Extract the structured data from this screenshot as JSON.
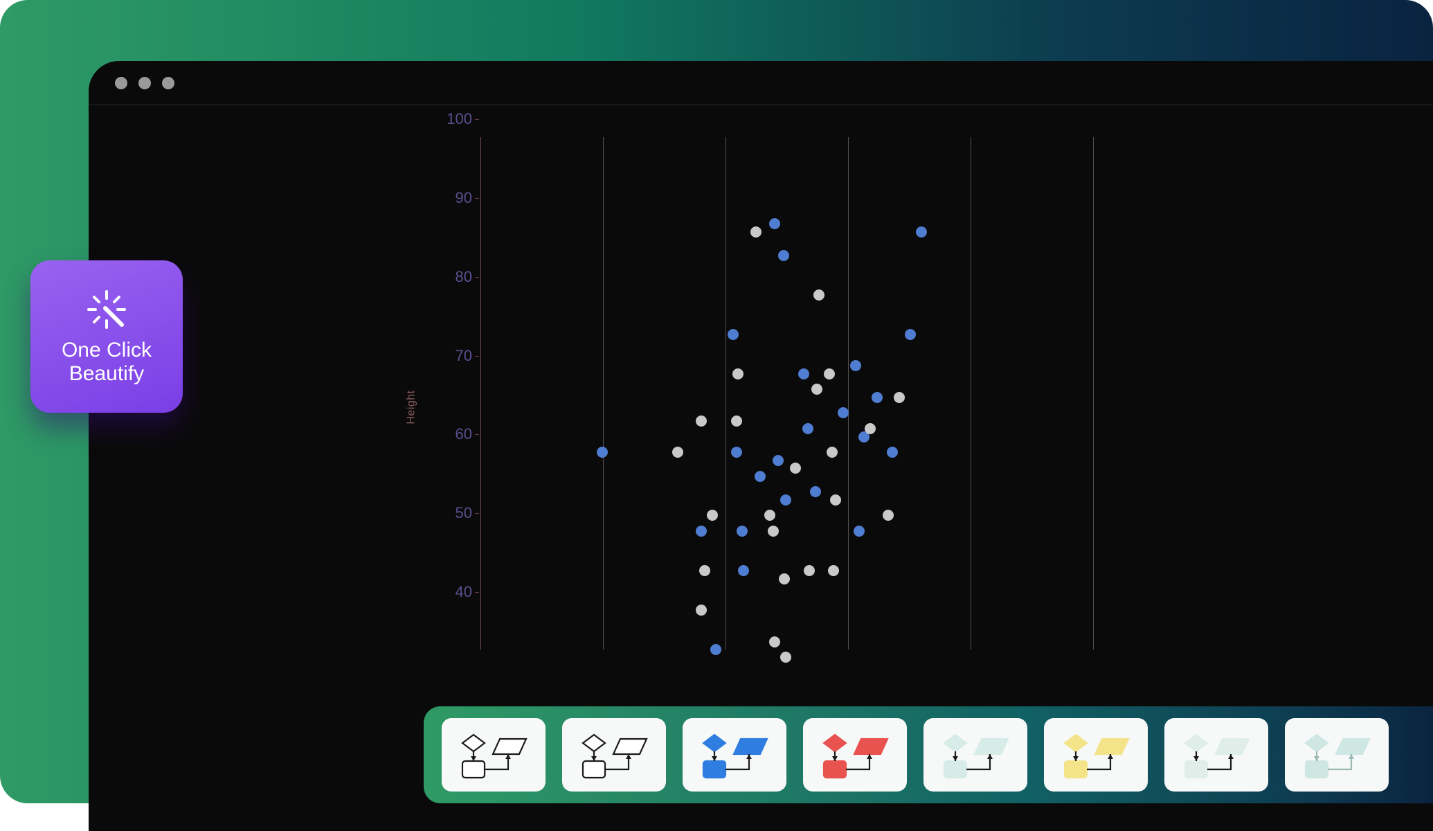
{
  "window": {
    "titlebar_dots": 3
  },
  "beautify": {
    "label_line1": "One Click",
    "label_line2": "Beautify"
  },
  "chart_data": {
    "type": "scatter",
    "ylabel": "Height",
    "ylim": [
      35,
      100
    ],
    "y_ticks": [
      40,
      50,
      60,
      70,
      80,
      90,
      100
    ],
    "x_gridlines": 5,
    "series": [
      {
        "name": "blue",
        "color": "#4f7dd1",
        "points": [
          {
            "x": 0.166,
            "y": 60
          },
          {
            "x": 0.3,
            "y": 50
          },
          {
            "x": 0.32,
            "y": 35
          },
          {
            "x": 0.344,
            "y": 75
          },
          {
            "x": 0.348,
            "y": 60
          },
          {
            "x": 0.356,
            "y": 50
          },
          {
            "x": 0.358,
            "y": 45
          },
          {
            "x": 0.4,
            "y": 89
          },
          {
            "x": 0.38,
            "y": 57
          },
          {
            "x": 0.405,
            "y": 59
          },
          {
            "x": 0.412,
            "y": 85
          },
          {
            "x": 0.415,
            "y": 54
          },
          {
            "x": 0.44,
            "y": 70
          },
          {
            "x": 0.445,
            "y": 63
          },
          {
            "x": 0.456,
            "y": 55
          },
          {
            "x": 0.51,
            "y": 71
          },
          {
            "x": 0.493,
            "y": 65
          },
          {
            "x": 0.515,
            "y": 50
          },
          {
            "x": 0.522,
            "y": 62
          },
          {
            "x": 0.54,
            "y": 67
          },
          {
            "x": 0.56,
            "y": 60
          },
          {
            "x": 0.585,
            "y": 75
          },
          {
            "x": 0.6,
            "y": 88
          }
        ]
      },
      {
        "name": "white",
        "color": "#c9c9c9",
        "points": [
          {
            "x": 0.268,
            "y": 60
          },
          {
            "x": 0.3,
            "y": 64
          },
          {
            "x": 0.3,
            "y": 40
          },
          {
            "x": 0.305,
            "y": 45
          },
          {
            "x": 0.315,
            "y": 52
          },
          {
            "x": 0.348,
            "y": 64
          },
          {
            "x": 0.35,
            "y": 70
          },
          {
            "x": 0.375,
            "y": 88
          },
          {
            "x": 0.394,
            "y": 52
          },
          {
            "x": 0.398,
            "y": 50
          },
          {
            "x": 0.4,
            "y": 36
          },
          {
            "x": 0.413,
            "y": 44
          },
          {
            "x": 0.415,
            "y": 34
          },
          {
            "x": 0.428,
            "y": 58
          },
          {
            "x": 0.447,
            "y": 45
          },
          {
            "x": 0.46,
            "y": 80
          },
          {
            "x": 0.458,
            "y": 68
          },
          {
            "x": 0.475,
            "y": 70
          },
          {
            "x": 0.478,
            "y": 60
          },
          {
            "x": 0.48,
            "y": 45
          },
          {
            "x": 0.483,
            "y": 54
          },
          {
            "x": 0.53,
            "y": 63
          },
          {
            "x": 0.57,
            "y": 67
          },
          {
            "x": 0.555,
            "y": 52
          }
        ]
      }
    ]
  },
  "theme_strip": {
    "themes": [
      {
        "name": "outline-light",
        "primary": "#ffffff",
        "stroke": "#1a1a1a"
      },
      {
        "name": "outline-bold",
        "primary": "#ffffff",
        "stroke": "#1a1a1a"
      },
      {
        "name": "blue",
        "primary": "#2f7de1",
        "stroke": "#1a1a1a"
      },
      {
        "name": "red",
        "primary": "#e8524f",
        "stroke": "#1a1a1a"
      },
      {
        "name": "mint",
        "primary": "#d7ece7",
        "stroke": "#1a1a1a"
      },
      {
        "name": "yellow",
        "primary": "#f3e48a",
        "stroke": "#1a1a1a"
      },
      {
        "name": "sage",
        "primary": "#dfeee8",
        "stroke": "#1a1a1a"
      },
      {
        "name": "aqua",
        "primary": "#cfe7e3",
        "stroke": "#9bb8b2"
      }
    ]
  }
}
